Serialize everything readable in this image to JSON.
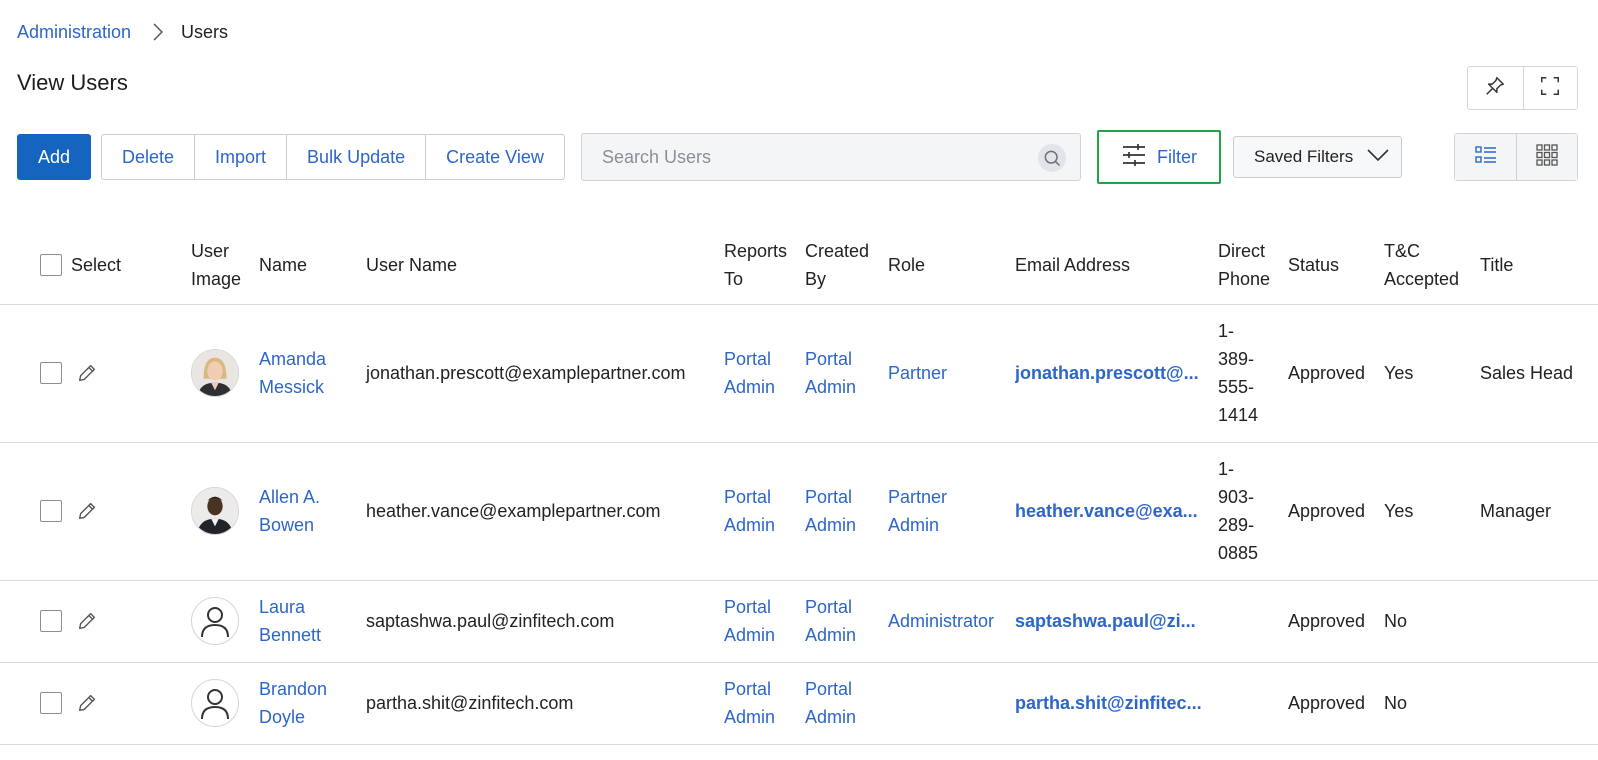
{
  "breadcrumb": {
    "parent": "Administration",
    "current": "Users"
  },
  "page_title": "View Users",
  "toolbar": {
    "add": "Add",
    "delete": "Delete",
    "import": "Import",
    "bulk_update": "Bulk Update",
    "create_view": "Create View",
    "search_placeholder": "Search Users",
    "filter": "Filter",
    "saved_filters": "Saved Filters"
  },
  "colors": {
    "primary": "#1565c0",
    "link": "#2d66c8",
    "filter_highlight": "#22a445"
  },
  "table": {
    "headers": {
      "select": "Select",
      "user_image_1": "User",
      "user_image_2": "Image",
      "name": "Name",
      "user_name": "User Name",
      "reports_to_1": "Reports",
      "reports_to_2": "To",
      "created_by_1": "Created",
      "created_by_2": "By",
      "role": "Role",
      "email": "Email Address",
      "phone_1": "Direct",
      "phone_2": "Phone",
      "status": "Status",
      "tc_1": "T&C",
      "tc_2": "Accepted",
      "title": "Title"
    },
    "rows": [
      {
        "avatar": "photo-woman",
        "name_1": "Amanda",
        "name_2": "Messick",
        "user_name": "jonathan.prescott@examplepartner.com",
        "reports_1": "Portal",
        "reports_2": "Admin",
        "created_1": "Portal",
        "created_2": "Admin",
        "role_1": "Partner",
        "role_2": "",
        "email": "jonathan.prescott@...",
        "phone_1": "1-",
        "phone_2": "389-",
        "phone_3": "555-",
        "phone_4": "1414",
        "status": "Approved",
        "tc": "Yes",
        "title": "Sales Head"
      },
      {
        "avatar": "photo-man",
        "name_1": "Allen A.",
        "name_2": "Bowen",
        "user_name": "heather.vance@examplepartner.com",
        "reports_1": "Portal",
        "reports_2": "Admin",
        "created_1": "Portal",
        "created_2": "Admin",
        "role_1": "Partner",
        "role_2": "Admin",
        "email": "heather.vance@exa...",
        "phone_1": "1-",
        "phone_2": "903-",
        "phone_3": "289-",
        "phone_4": "0885",
        "status": "Approved",
        "tc": "Yes",
        "title": "Manager"
      },
      {
        "avatar": "default-user-icon",
        "name_1": "Laura",
        "name_2": "Bennett",
        "user_name": "saptashwa.paul@zinfitech.com",
        "reports_1": "Portal",
        "reports_2": "Admin",
        "created_1": "Portal",
        "created_2": "Admin",
        "role_1": "Administrator",
        "role_2": "",
        "email": "saptashwa.paul@zi...",
        "phone_1": "",
        "phone_2": "",
        "phone_3": "",
        "phone_4": "",
        "status": "Approved",
        "tc": "No",
        "title": ""
      },
      {
        "avatar": "default-user-icon",
        "name_1": "Brandon",
        "name_2": "Doyle",
        "user_name": "partha.shit@zinfitech.com",
        "reports_1": "Portal",
        "reports_2": "Admin",
        "created_1": "Portal",
        "created_2": "Admin",
        "role_1": "",
        "role_2": "",
        "email": "partha.shit@zinfitec...",
        "phone_1": "",
        "phone_2": "",
        "phone_3": "",
        "phone_4": "",
        "status": "Approved",
        "tc": "No",
        "title": ""
      }
    ]
  }
}
